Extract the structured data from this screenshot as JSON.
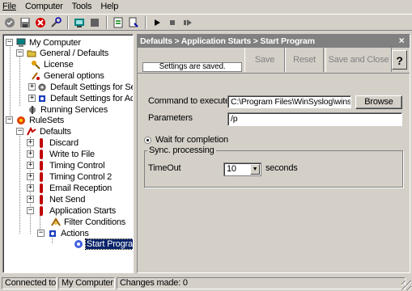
{
  "menu": [
    "File",
    "Computer",
    "Tools",
    "Help"
  ],
  "toolbar": [
    "check-icon",
    "save-icon",
    "delete-icon",
    "refresh-icon",
    "users-icon",
    "stop-icon",
    "settings-icon",
    "export-icon",
    "play-icon",
    "stop-small-icon",
    "step-icon"
  ],
  "tree": {
    "my_computer": "My Computer",
    "general_defaults": "General / Defaults",
    "license": "License",
    "general_options": "General options",
    "default_settings_services": "Default Settings for Services",
    "default_settings_actions": "Default Settings for Actions",
    "running_services": "Running Services",
    "rulesets": "RuleSets",
    "defaults": "Defaults",
    "discard": "Discard",
    "write_to_file": "Write to File",
    "timing_control": "Timing Control",
    "timing_control_2": "Timing Control 2",
    "email_reception": "Email Reception",
    "net_send": "Net Send",
    "application_starts": "Application Starts",
    "filter_conditions": "Filter Conditions",
    "actions": "Actions",
    "start_program": "Start Program"
  },
  "panel": {
    "breadcrumb": "Defaults > Application Starts > Start Program",
    "close": "×",
    "status": "Settings are saved.",
    "save": "Save",
    "reset": "Reset",
    "save_and_close": "Save and Close",
    "help": "?",
    "command_label": "Command to execute",
    "command_value": "C:\\Program Files\\WinSyslog\\winsyslog.exe",
    "browse": "Browse",
    "parameters_label": "Parameters",
    "parameters_value": "/p",
    "wait_label": "Wait for completion",
    "sync_group": "Sync. processing",
    "timeout_label": "TimeOut",
    "timeout_value": "10",
    "seconds": "seconds"
  },
  "statusbar": {
    "connected_label": "Connected to:",
    "connected_value": "My Computer",
    "changes": "Changes made: 0"
  }
}
